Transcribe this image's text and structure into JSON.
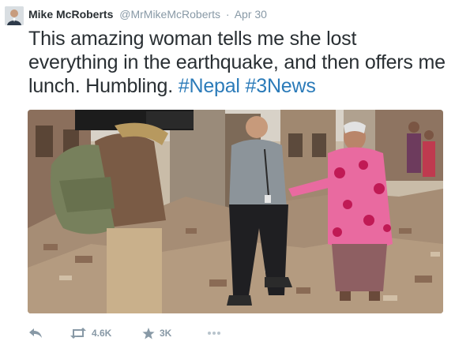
{
  "tweet": {
    "author_name": "Mike McRoberts",
    "author_handle": "@MrMikeMcRoberts",
    "separator": "·",
    "date": "Apr 30",
    "text": "This amazing woman tells me she lost everything in the earthquake, and then offers me lunch. Humbling.",
    "hashtags": [
      "#Nepal",
      "#3News"
    ]
  },
  "actions": {
    "reply_icon": "reply-icon",
    "retweet_icon": "retweet-icon",
    "retweet_count": "4.6K",
    "favorite_icon": "star-icon",
    "favorite_count": "3K",
    "more_icon": "more-icon"
  },
  "colors": {
    "link": "#2b7bb9",
    "text": "#292f33",
    "muted": "#8899a6"
  }
}
